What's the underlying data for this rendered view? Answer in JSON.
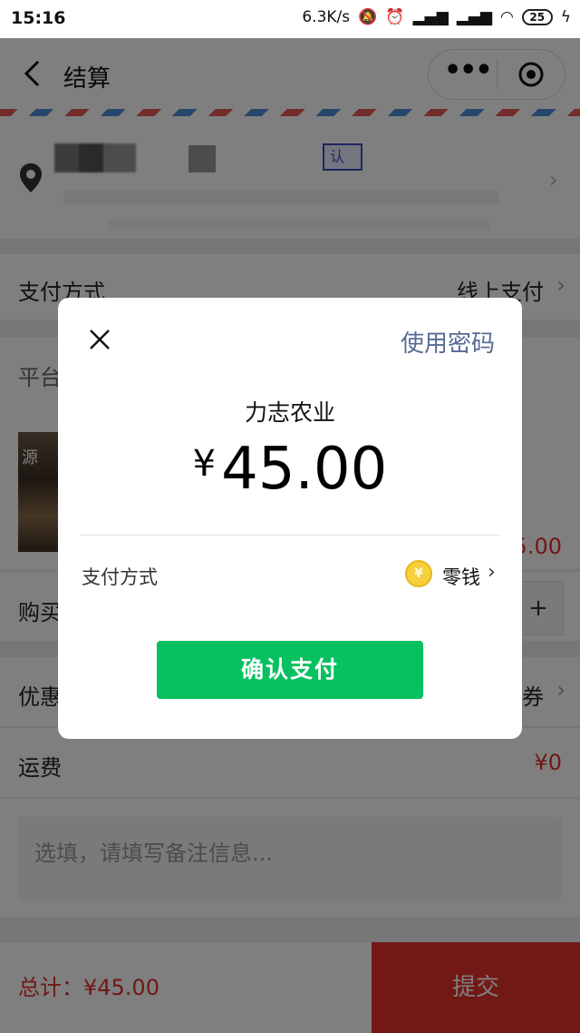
{
  "status_bar": {
    "time": "15:16",
    "net_speed": "6.3K/s",
    "battery": "25"
  },
  "nav": {
    "title": "结算",
    "more_icon": "ellipsis-icon",
    "close_icon": "target-icon"
  },
  "address": {
    "tag": "认"
  },
  "rows": {
    "payment": {
      "label": "支付方式",
      "value": "线上支付"
    },
    "platform": {
      "label": "平台"
    },
    "quantity": {
      "label": "购买",
      "plus": "+"
    },
    "coupon": {
      "label": "优惠",
      "value": "券"
    },
    "shipping": {
      "label": "运费",
      "value": "¥0"
    }
  },
  "product": {
    "price_fragment": "5.00",
    "img_text": "源"
  },
  "remark": {
    "placeholder": "选填，请填写备注信息..."
  },
  "footer": {
    "total": "总计：¥45.00",
    "submit": "提交"
  },
  "dialog": {
    "use_password": "使用密码",
    "merchant": "力志农业",
    "currency": "¥",
    "amount": "45.00",
    "pay_method_label": "支付方式",
    "pay_method_value": "零钱",
    "coin_symbol": "¥",
    "confirm": "确认支付"
  },
  "colors": {
    "accent_green": "#07c160",
    "price_red": "#e3302b",
    "link_blue": "#576b95"
  }
}
